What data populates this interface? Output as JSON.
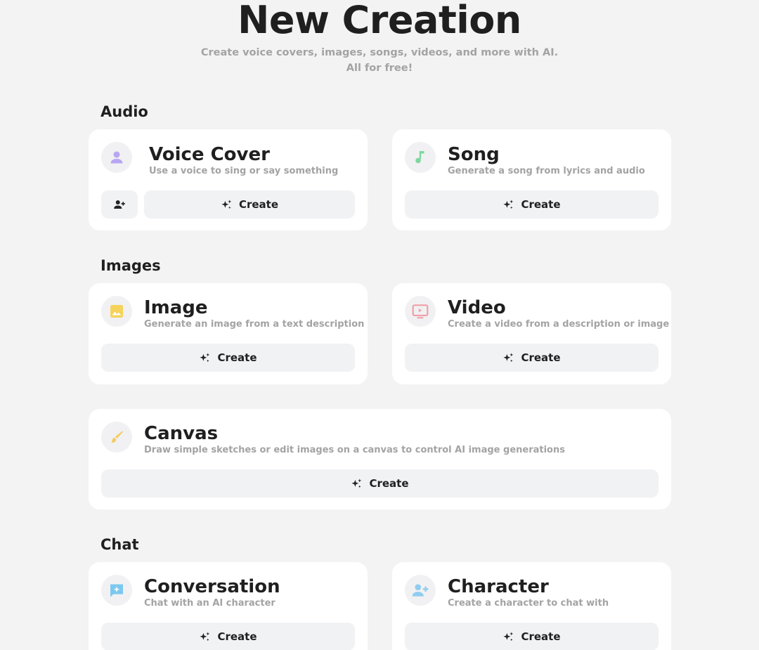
{
  "header": {
    "title": "New Creation",
    "subtitle_line1": "Create voice covers, images, songs, videos, and more with AI.",
    "subtitle_line2": "All for free!"
  },
  "sections": {
    "audio": {
      "label": "Audio"
    },
    "images": {
      "label": "Images"
    },
    "chat": {
      "label": "Chat"
    }
  },
  "cards": {
    "voice_cover": {
      "title": "Voice Cover",
      "description": "Use a voice to sing or say something",
      "icon": "person-icon",
      "icon_color": "#b9a6f2",
      "create_label": "Create",
      "secondary_icon": "person-add-icon"
    },
    "song": {
      "title": "Song",
      "description": "Generate a song from lyrics and audio",
      "icon": "music-note-icon",
      "icon_color": "#7fd6a0",
      "create_label": "Create"
    },
    "image": {
      "title": "Image",
      "description": "Generate an image from a text description",
      "icon": "image-icon",
      "icon_color": "#f5d35a",
      "create_label": "Create"
    },
    "video": {
      "title": "Video",
      "description": "Create a video from a description or image",
      "icon": "video-screen-icon",
      "icon_color": "#f0a0a8",
      "create_label": "Create"
    },
    "canvas": {
      "title": "Canvas",
      "description": "Draw simple sketches or edit images on a canvas to control AI image generations",
      "icon": "brush-icon",
      "icon_color": "#f7c95a",
      "create_label": "Create"
    },
    "conversation": {
      "title": "Conversation",
      "description": "Chat with an AI character",
      "icon": "chat-sparkle-icon",
      "icon_color": "#7cc8ef",
      "create_label": "Create"
    },
    "character": {
      "title": "Character",
      "description": "Create a character to chat with",
      "icon": "person-add-icon",
      "icon_color": "#8fcdf0",
      "create_label": "Create"
    }
  }
}
